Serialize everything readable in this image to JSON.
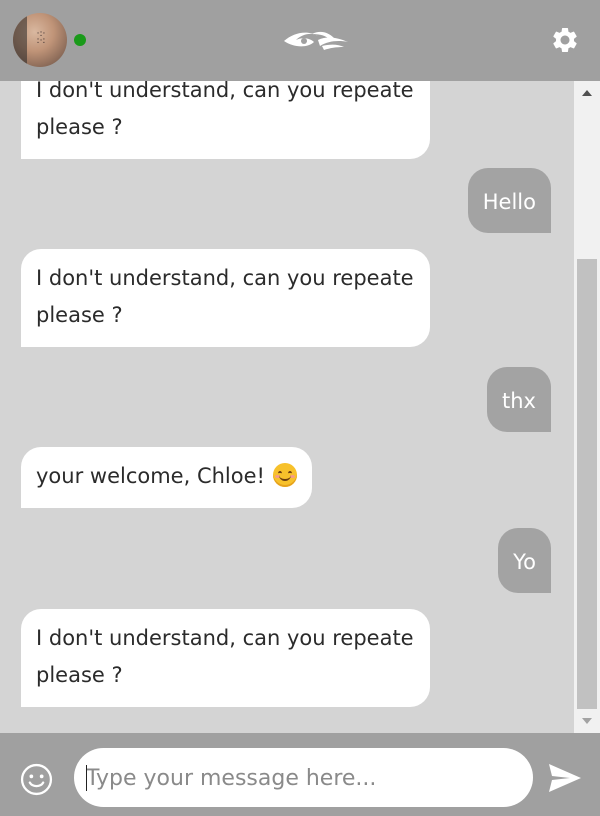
{
  "header": {
    "avatar_alt": "",
    "status": "online",
    "logo_icon": "eye-wave-logo",
    "settings_icon": "gear-icon"
  },
  "messages": [
    {
      "from": "bot",
      "text": "I don't understand, can you repeate please ?"
    },
    {
      "from": "user",
      "text": "Hello"
    },
    {
      "from": "bot",
      "text": "I don't understand, can you repeate please ?"
    },
    {
      "from": "user",
      "text": "thx"
    },
    {
      "from": "bot",
      "text": "your welcome, Chloe!",
      "emoji": "smiling-face"
    },
    {
      "from": "user",
      "text": "Yo"
    },
    {
      "from": "bot",
      "text": "I don't understand, can you repeate please ?"
    }
  ],
  "composer": {
    "placeholder": "Type your message here...",
    "value": "",
    "emoji_icon": "smiley-icon",
    "send_icon": "send-icon"
  },
  "colors": {
    "header_bg": "#a0a0a0",
    "chat_bg": "#d4d4d4",
    "bot_bubble": "#ffffff",
    "user_bubble": "#a3a3a3",
    "online": "#1a9a1a"
  }
}
